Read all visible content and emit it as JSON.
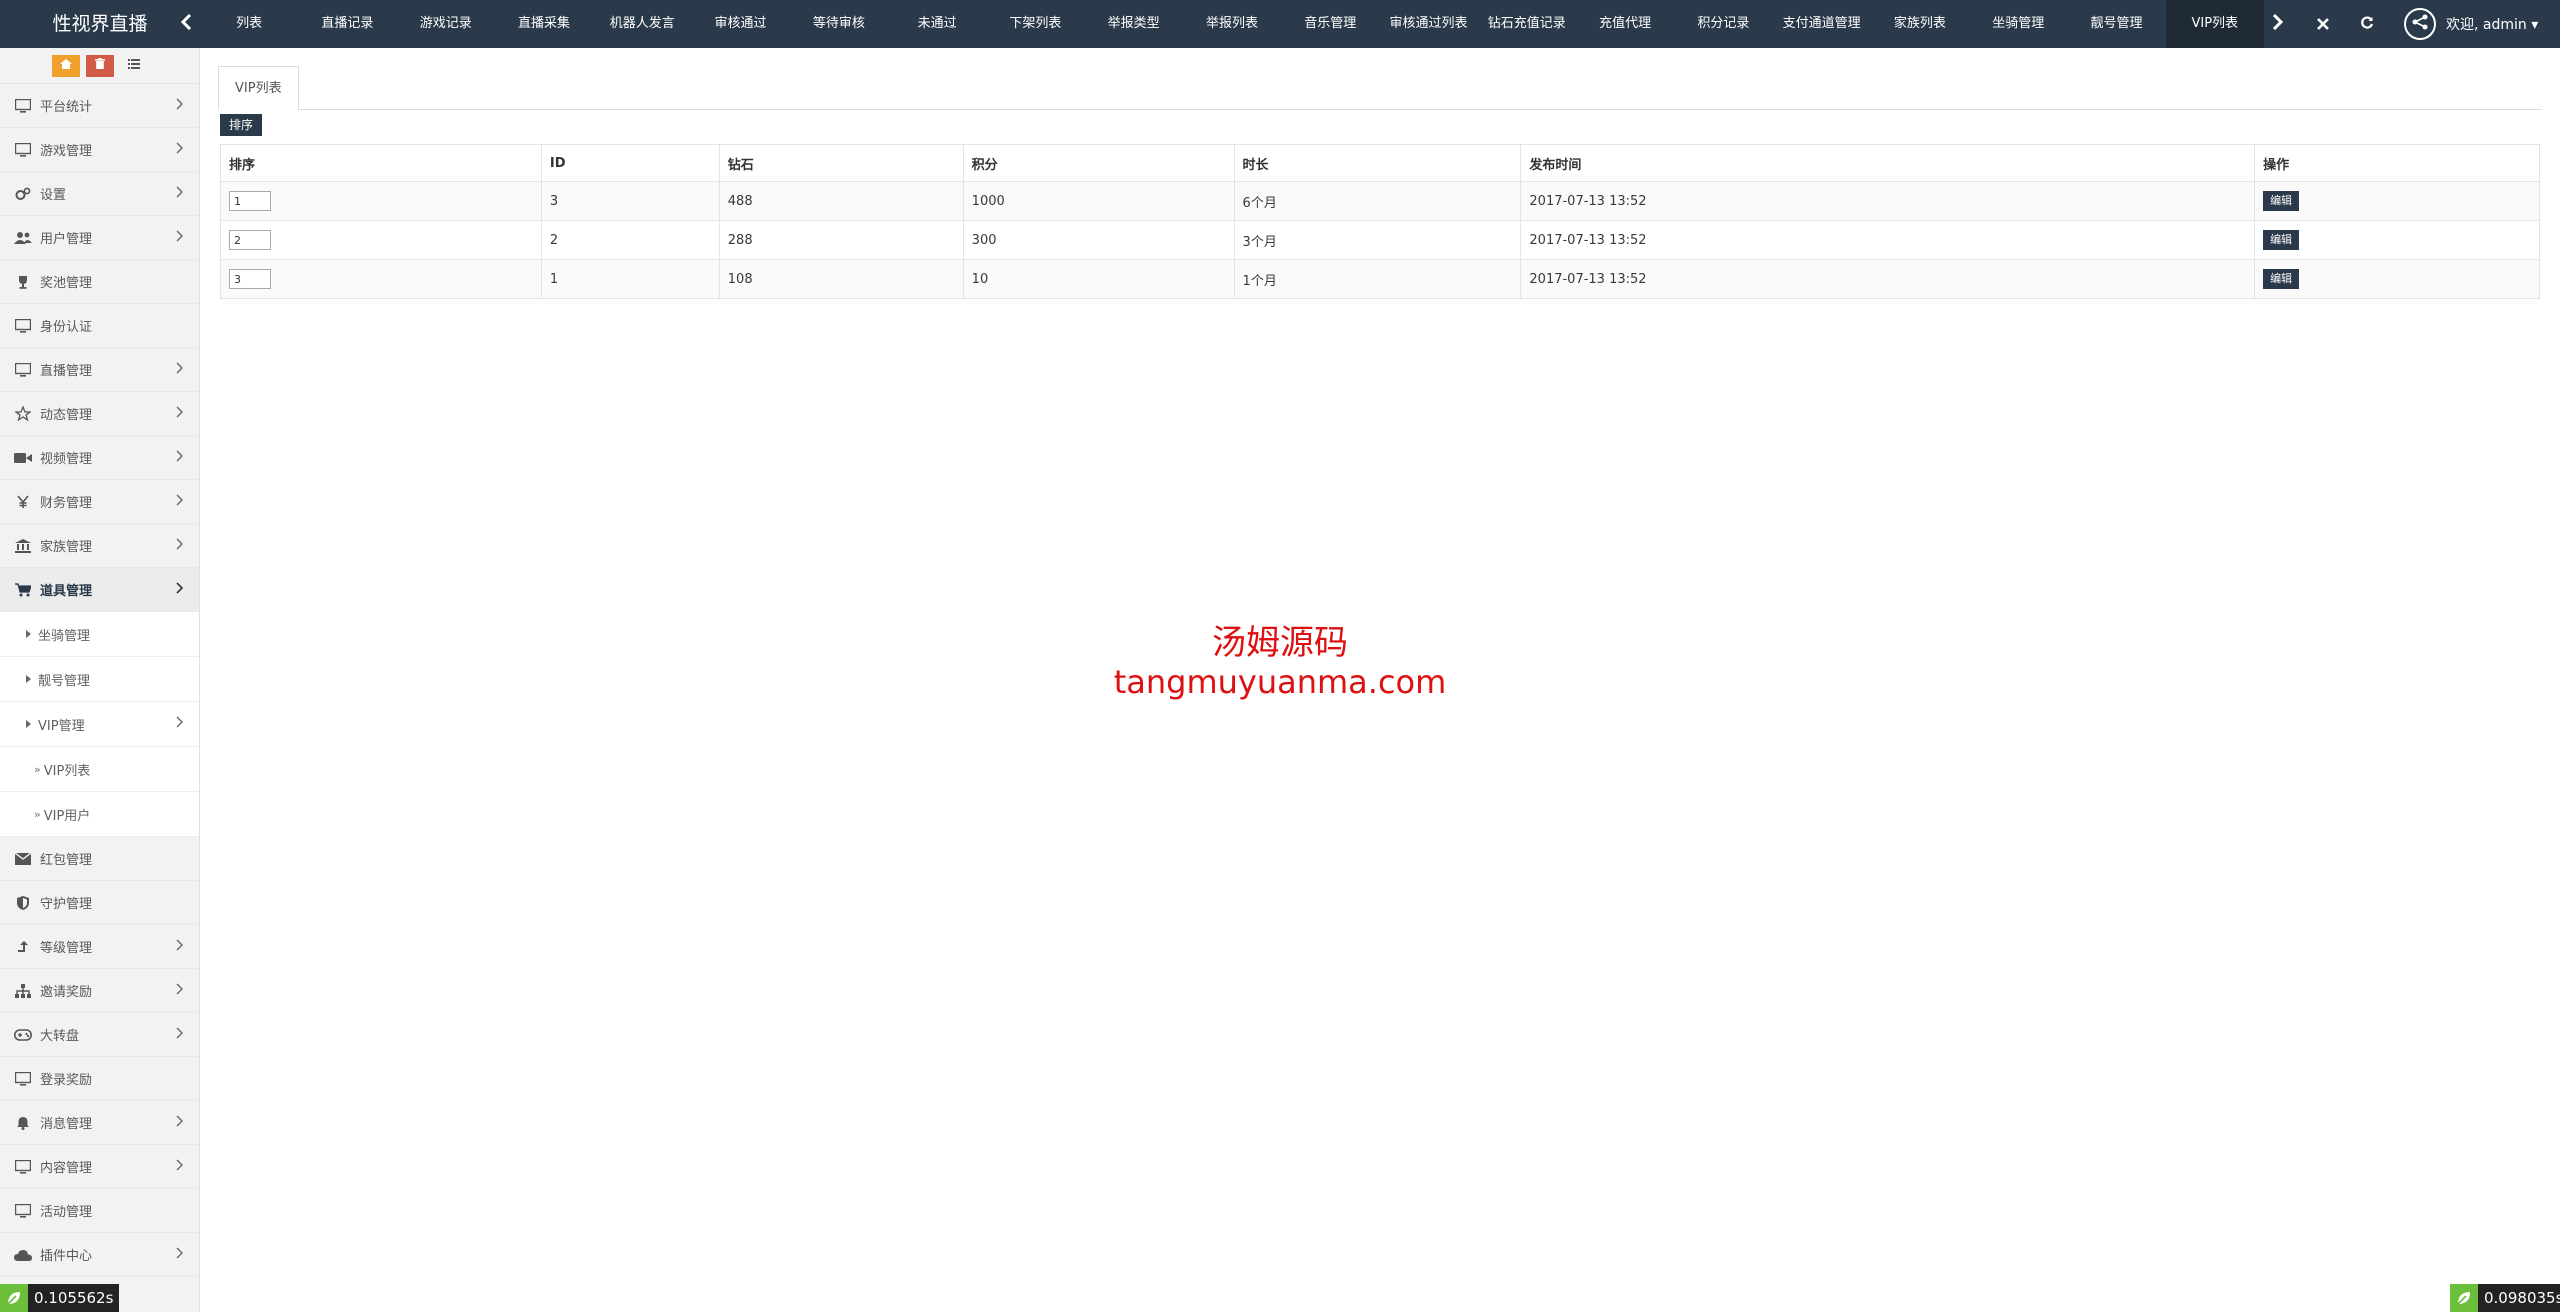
{
  "app": {
    "brand": "性视界直播"
  },
  "nav": {
    "tabs": [
      "列表",
      "直播记录",
      "游戏记录",
      "直播采集",
      "机器人发言",
      "审核通过",
      "等待审核",
      "未通过",
      "下架列表",
      "举报类型",
      "举报列表",
      "音乐管理",
      "审核通过列表",
      "钻石充值记录",
      "充值代理",
      "积分记录",
      "支付通道管理",
      "家族列表",
      "坐骑管理",
      "靓号管理",
      "VIP列表"
    ],
    "active_tab": "VIP列表",
    "user_label": "欢迎, admin ▾"
  },
  "sidebar": {
    "items": [
      {
        "label": "平台统计",
        "icon": "monitor-icon",
        "arrow": true
      },
      {
        "label": "游戏管理",
        "icon": "monitor-icon",
        "arrow": true
      },
      {
        "label": "设置",
        "icon": "cogs-icon",
        "arrow": true
      },
      {
        "label": "用户管理",
        "icon": "users-icon",
        "arrow": true
      },
      {
        "label": "奖池管理",
        "icon": "trophy-icon",
        "arrow": false
      },
      {
        "label": "身份认证",
        "icon": "monitor-icon",
        "arrow": false
      },
      {
        "label": "直播管理",
        "icon": "monitor-icon",
        "arrow": true
      },
      {
        "label": "动态管理",
        "icon": "star-icon",
        "arrow": true
      },
      {
        "label": "视频管理",
        "icon": "video-icon",
        "arrow": true
      },
      {
        "label": "财务管理",
        "icon": "yen-icon",
        "arrow": true
      },
      {
        "label": "家族管理",
        "icon": "bank-icon",
        "arrow": true
      },
      {
        "label": "道具管理",
        "icon": "cart-icon",
        "arrow": true,
        "open": true
      }
    ],
    "sub_items": [
      {
        "label": "坐骑管理",
        "arrow": false
      },
      {
        "label": "靓号管理",
        "arrow": false
      },
      {
        "label": "VIP管理",
        "arrow": true
      }
    ],
    "subsub_items": [
      "VIP列表",
      "VIP用户"
    ],
    "items_after": [
      {
        "label": "红包管理",
        "icon": "envelope-icon",
        "arrow": false
      },
      {
        "label": "守护管理",
        "icon": "shield-icon",
        "arrow": false
      },
      {
        "label": "等级管理",
        "icon": "level-up-icon",
        "arrow": true
      },
      {
        "label": "邀请奖励",
        "icon": "sitemap-icon",
        "arrow": true
      },
      {
        "label": "大转盘",
        "icon": "gamepad-icon",
        "arrow": true
      },
      {
        "label": "登录奖励",
        "icon": "monitor-icon",
        "arrow": false
      },
      {
        "label": "消息管理",
        "icon": "bell-icon",
        "arrow": true
      },
      {
        "label": "内容管理",
        "icon": "monitor-icon",
        "arrow": true
      },
      {
        "label": "活动管理",
        "icon": "monitor-icon",
        "arrow": false
      },
      {
        "label": "插件中心",
        "icon": "cloud-icon",
        "arrow": true
      }
    ]
  },
  "content": {
    "tab_label": "VIP列表",
    "sort_button": "排序",
    "table": {
      "headers": [
        "排序",
        "ID",
        "钻石",
        "积分",
        "时长",
        "发布时间",
        "操作"
      ],
      "rows": [
        {
          "sort": "1",
          "id": "3",
          "diamonds": "488",
          "points": "1000",
          "duration": "6个月",
          "time": "2017-07-13 13:52",
          "action": "编辑"
        },
        {
          "sort": "2",
          "id": "2",
          "diamonds": "288",
          "points": "300",
          "duration": "3个月",
          "time": "2017-07-13 13:52",
          "action": "编辑"
        },
        {
          "sort": "3",
          "id": "1",
          "diamonds": "108",
          "points": "10",
          "duration": "1个月",
          "time": "2017-07-13 13:52",
          "action": "编辑"
        }
      ]
    }
  },
  "watermark": {
    "cn": "汤姆源码",
    "en": "tangmuyuanma.com"
  },
  "debug": {
    "left": "0.105562s",
    "right": "0.098035s"
  },
  "colors": {
    "navbar": "#2b3a4b",
    "active_tab": "#1f2a36",
    "orange": "#f0a02b",
    "red": "#d15b47",
    "watermark": "#dd1111",
    "debug_icon": "#6bbf3a"
  }
}
